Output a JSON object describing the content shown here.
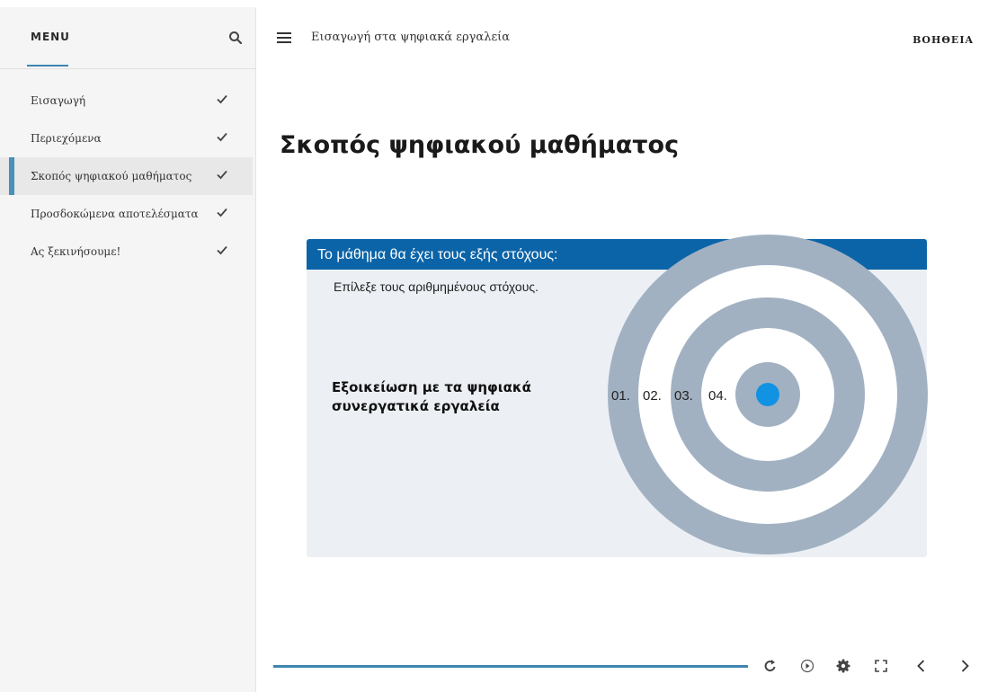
{
  "sidebar": {
    "menu_label": "MENU",
    "search_icon": "search-icon",
    "items": [
      {
        "label": "Εισαγωγή",
        "completed": true,
        "active": false
      },
      {
        "label": "Περιεχόμενα",
        "completed": true,
        "active": false
      },
      {
        "label": "Σκοπός ψηφιακού μαθήματος",
        "completed": true,
        "active": true
      },
      {
        "label": "Προσδοκώμενα αποτελέσματα",
        "completed": true,
        "active": false
      },
      {
        "label": "Ας ξεκινήσουμε!",
        "completed": true,
        "active": false
      }
    ]
  },
  "topbar": {
    "course_title": "Εισαγωγή στα ψηφιακά εργαλεία",
    "help_label": "ΒΟΗΘΕΙΑ"
  },
  "main": {
    "page_title": "Σκοπός ψηφιακού μαθήματος",
    "card": {
      "header": "Το μάθημα θα έχει τους εξής στόχους:",
      "instruction": "Επίλεξε τους αριθμημένους στόχους.",
      "goal_line1": "Εξοικείωση με τα ψηφιακά",
      "goal_line2": "συνεργατικά εργαλεία",
      "targets": [
        "01.",
        "02.",
        "03.",
        "04."
      ]
    }
  },
  "player": {
    "progress": 1.0,
    "controls": [
      "replay-icon",
      "play-icon",
      "settings-icon",
      "fullscreen-icon",
      "previous-icon",
      "next-icon"
    ]
  },
  "colors": {
    "accent": "#3e86b0",
    "card_header": "#0c64a8",
    "card_bg": "#ecf0f5",
    "ring": "#a2b1c2",
    "dot": "#1192e2"
  }
}
